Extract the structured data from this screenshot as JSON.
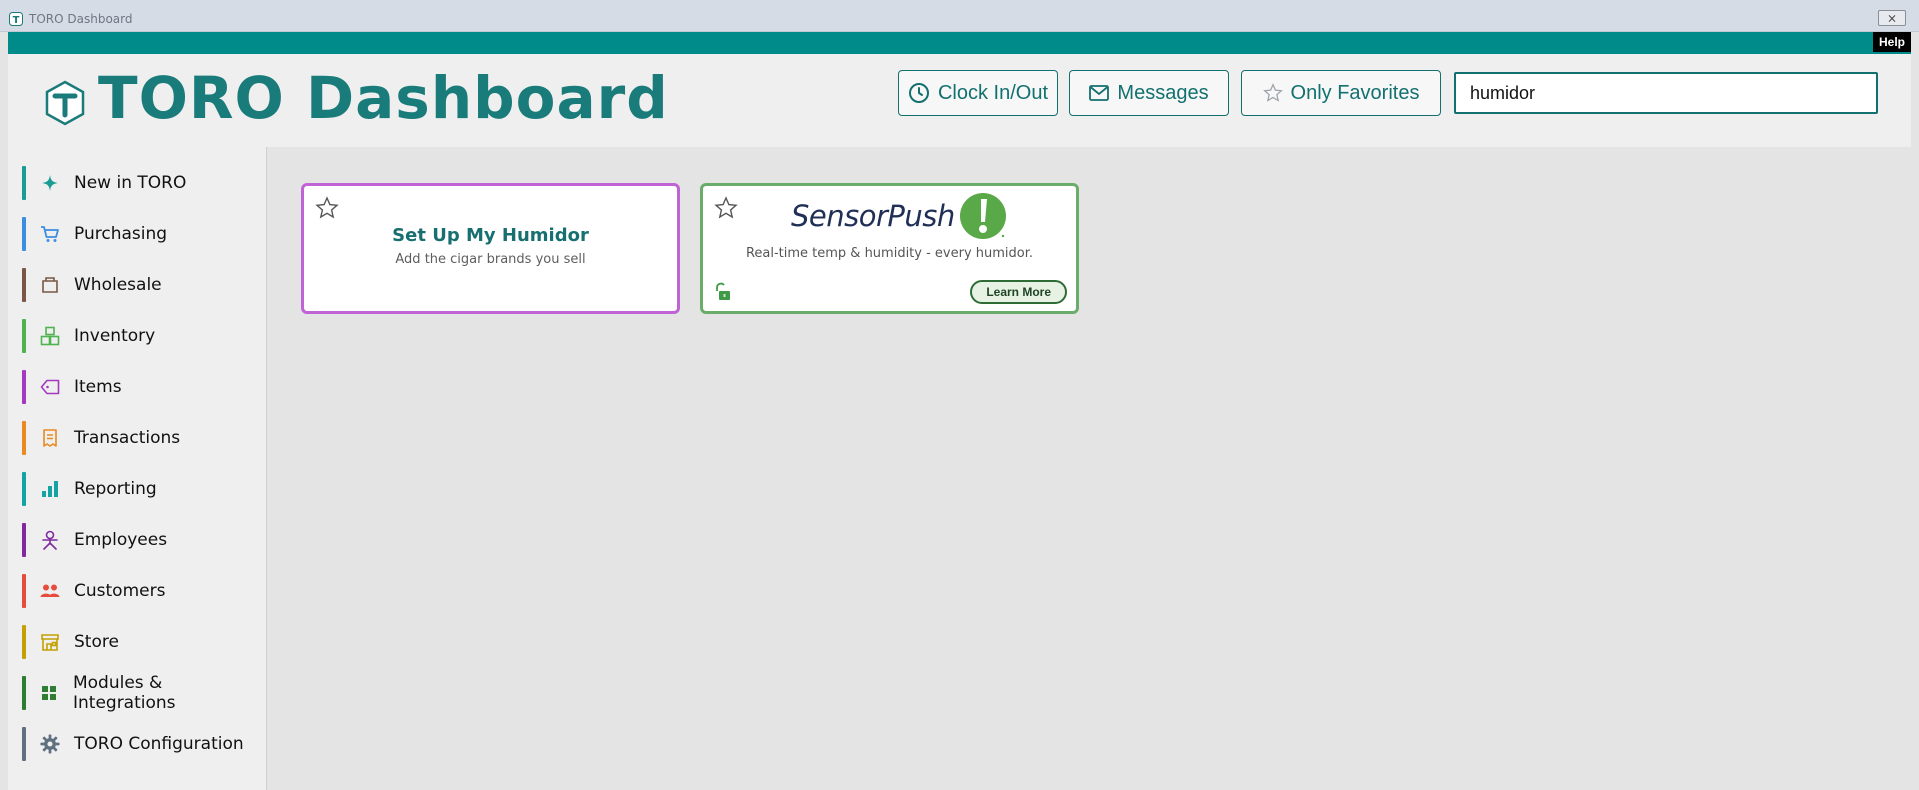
{
  "window": {
    "title": "TORO Dashboard",
    "close_glyph": "⨯"
  },
  "strip": {
    "help_label": "Help"
  },
  "header": {
    "brand": "TORO Dashboard",
    "clock_label": "Clock In/Out",
    "messages_label": "Messages",
    "favorites_label": "Only Favorites",
    "search_value": "humidor"
  },
  "sidebar": {
    "items": [
      {
        "label": "New in TORO",
        "color": "#1a9c95",
        "icon": "sparkle-icon"
      },
      {
        "label": "Purchasing",
        "color": "#3b8fe0",
        "icon": "cart-icon"
      },
      {
        "label": "Wholesale",
        "color": "#7a5646",
        "icon": "box-icon"
      },
      {
        "label": "Inventory",
        "color": "#4fb34f",
        "icon": "boxes-icon"
      },
      {
        "label": "Items",
        "color": "#a438c0",
        "icon": "tag-icon"
      },
      {
        "label": "Transactions",
        "color": "#e98a20",
        "icon": "receipt-icon"
      },
      {
        "label": "Reporting",
        "color": "#16a3a3",
        "icon": "bar-chart-icon"
      },
      {
        "label": "Employees",
        "color": "#7f2aa0",
        "icon": "employee-icon"
      },
      {
        "label": "Customers",
        "color": "#e74c3c",
        "icon": "people-icon"
      },
      {
        "label": "Store",
        "color": "#c4a100",
        "icon": "store-icon"
      },
      {
        "label": "Modules & Integrations",
        "color": "#2e7d32",
        "icon": "grid-icon"
      },
      {
        "label": "TORO Configuration",
        "color": "#607080",
        "icon": "gear-icon"
      }
    ]
  },
  "cards": {
    "humidor": {
      "title": "Set Up My Humidor",
      "subtitle": "Add the cigar brands you sell"
    },
    "sensorpush": {
      "brand": "SensorPush",
      "subtitle": "Real-time temp & humidity - every humidor.",
      "button": "Learn More"
    }
  }
}
